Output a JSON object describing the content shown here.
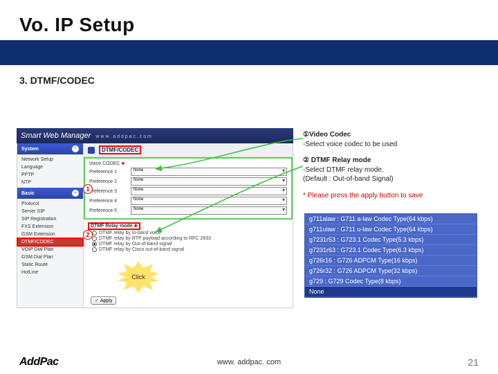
{
  "slide": {
    "title": "Vo. IP Setup",
    "subheading": "3. DTMF/CODEC",
    "page_number": "21",
    "footer_url": "www. addpac. com",
    "logo": "AddPac"
  },
  "swm": {
    "bar_title": "Smart Web Manager",
    "bar_url": "w w w . a d d p a c . c o m",
    "sidebar": {
      "section1": "System",
      "items1": [
        "Network Setup",
        "Language",
        "PPTP",
        "NTP"
      ],
      "section2": "Basic",
      "items2": [
        "Protocol",
        "Server SIP",
        "SIP Registration",
        "FXS Extension",
        "GSM Extension",
        "DTMF/CODEC",
        "VOIP Dial Plan",
        "GSM Dial Plan",
        "Static Route",
        "HotLine"
      ]
    },
    "crumb_title": "DTMF/CODEC",
    "voice_codec_label": "Voice CODEC",
    "pref_labels": [
      "Preference 1",
      "Preference 2",
      "Preference 3",
      "Preference 4",
      "Preference 5"
    ],
    "pref_values": [
      "None",
      "None",
      "None",
      "None",
      "None"
    ],
    "dtmf_label": "DTMF Relay mode",
    "dtmf_options": [
      "DTMF relay by In-band voice",
      "DTMF relay by RTP payload according to RFC 2833",
      "DTMF relay by Out-of-band signal",
      "DTMF relay by Cisco out-of-band signal"
    ],
    "dtmf_selected_index": 2,
    "apply_label": "Apply",
    "burst_label": "Click"
  },
  "notes": {
    "n1_title": "①Video Codec",
    "n1_body": "-Select voice codec to be used",
    "n2_title": "② DTMF Relay mode",
    "n2_body1": "-Select DTMF relay mode.",
    "n2_body2": "(Default : Out-of-band Signal)",
    "apply_note": "* Please press the apply button to save"
  },
  "codec_list": [
    "g711alaw : G711 a-law Codec Type(64 kbps)",
    "g711ulaw : G711 u-law Codec Type(64 kbps)",
    "g7231r53 : G723.1 Codec Type(5.3 kbps)",
    "g7231r63 : G723.1 Codec Type(6.3 kbps)",
    "g726r16 : G726 ADPCM Type(16 kbps)",
    "g726r32 : G726 ADPCM Type(32 kbps)",
    "g729 : G729 Codec Type(8 kbps)"
  ],
  "codec_list_selected": "None"
}
